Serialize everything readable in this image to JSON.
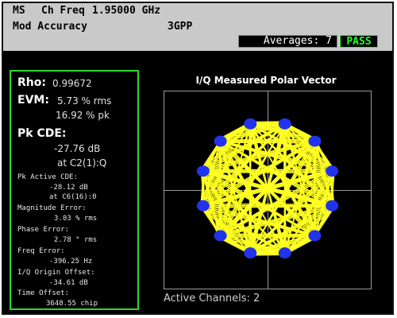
{
  "header": {
    "mode": "MS",
    "freq_label": "Ch Freq",
    "freq_value": "1.95000 GHz",
    "measurement": "Mod Accuracy",
    "standard": "3GPP",
    "averages_label": "Averages:",
    "averages_value": "7",
    "status": "PASS"
  },
  "results": {
    "rho_label": "Rho:",
    "rho_value": "0.99672",
    "evm_label": "EVM:",
    "evm_rms": "5.73 % rms",
    "evm_pk": "16.92 % pk",
    "pk_cde_label": "Pk CDE:",
    "pk_cde_value": "-27.76 dB",
    "pk_cde_at": "at C2(1):Q",
    "pk_active_cde_label": "Pk Active CDE:",
    "pk_active_cde_value": "-28.12 dB",
    "pk_active_cde_at": "at C6(16):0",
    "mag_err_label": "Magnitude Error:",
    "mag_err_value": "3.03 % rms",
    "phase_err_label": "Phase Error:",
    "phase_err_value": "2.78 ° rms",
    "freq_err_label": "Freq Error:",
    "freq_err_value": "-396.25 Hz",
    "iq_offset_label": "I/Q Origin Offset:",
    "iq_offset_value": "-34.61 dB",
    "time_offset_label": "Time Offset:",
    "time_offset_value": "3648.55 chip"
  },
  "plot": {
    "title": "I/Q Measured Polar Vector",
    "active_channels": "Active Channels: 2",
    "trace_color": "#ffff22",
    "symbol_color": "#2233ee",
    "grid_color": "#9a9a9a"
  },
  "colors": {
    "header_bg": "#c9c9c9",
    "screen_bg": "#000000",
    "panel_border": "#2bd82b",
    "pass_color": "#22ff22"
  }
}
